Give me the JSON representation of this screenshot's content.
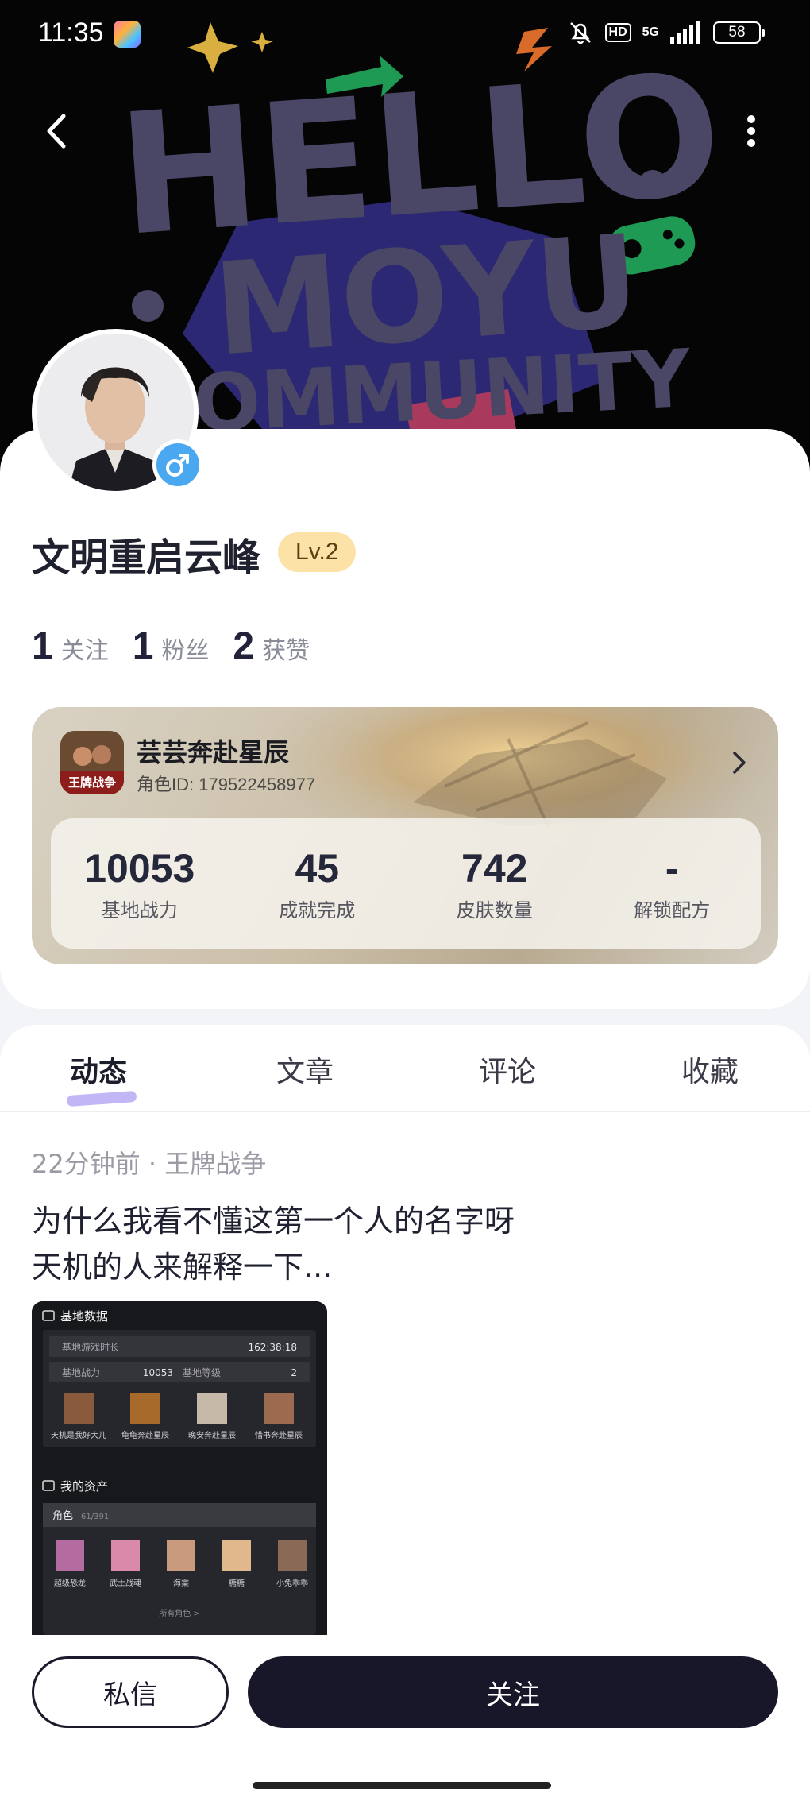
{
  "status_bar": {
    "time": "11:35",
    "hd": "HD",
    "network": "5G",
    "battery": "58"
  },
  "banner": {
    "line1": "HELLO",
    "line2": "MOYU",
    "line3": "COMMUNITY"
  },
  "profile": {
    "username": "文明重启云峰",
    "level": "Lv.2",
    "gender": "male",
    "stats": [
      {
        "value": "1",
        "label": "关注"
      },
      {
        "value": "1",
        "label": "粉丝"
      },
      {
        "value": "2",
        "label": "获赞"
      }
    ]
  },
  "game_card": {
    "role_name": "芸芸奔赴星辰",
    "role_id": "角色ID: 179522458977",
    "icon_text": "王牌战争",
    "stats": [
      {
        "value": "10053",
        "label": "基地战力"
      },
      {
        "value": "45",
        "label": "成就完成"
      },
      {
        "value": "742",
        "label": "皮肤数量"
      },
      {
        "value": "-",
        "label": "解锁配方"
      }
    ]
  },
  "tabs": [
    {
      "label": "动态",
      "active": true
    },
    {
      "label": "文章",
      "active": false
    },
    {
      "label": "评论",
      "active": false
    },
    {
      "label": "收藏",
      "active": false
    }
  ],
  "post": {
    "meta": "22分钟前 · 王牌战争",
    "line1": "为什么我看不懂这第一个人的名字呀",
    "line2": "天机的人来解释一下...",
    "image": {
      "section1_title": "基地数据",
      "row1_label": "基地游戏时长",
      "row1_value": "162:38:18",
      "row2_label": "基地战力",
      "row2_value": "10053",
      "row2_label_b": "基地等级",
      "row2_value_b": "2",
      "members": [
        "天机是我好大儿",
        "龟龟奔赴星辰",
        "晚安奔赴星辰",
        "惜书奔赴星辰"
      ],
      "section2_title": "我的资产",
      "assets_tab": "角色",
      "assets_count": "61/391",
      "characters": [
        "超级恐龙",
        "武士战魂",
        "海棠",
        "糖糖",
        "小兔乖乖"
      ],
      "all_roles": "所有角色 >"
    }
  },
  "actions": {
    "message": "私信",
    "follow": "关注"
  }
}
